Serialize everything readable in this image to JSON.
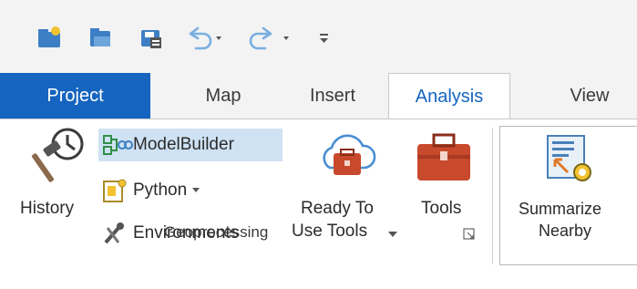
{
  "quick_access": {
    "icons": [
      "new-project-icon",
      "open-project-icon",
      "save-project-icon",
      "undo-icon",
      "redo-icon",
      "customize-icon"
    ]
  },
  "tabs": [
    {
      "label": "Project"
    },
    {
      "label": "Map"
    },
    {
      "label": "Insert"
    },
    {
      "label": "Analysis"
    },
    {
      "label": "View"
    }
  ],
  "ribbon": {
    "geoprocessing": {
      "group_label": "Geoprocessing",
      "history_label": "History",
      "modelbuilder_label": "ModelBuilder",
      "python_label": "Python",
      "environments_label": "Environments",
      "ready_tools_line1": "Ready To",
      "ready_tools_line2": "Use Tools",
      "tools_label": "Tools"
    },
    "summarize": {
      "line1": "Summarize",
      "line2": "Nearby"
    }
  },
  "colors": {
    "accent": "#1565c0",
    "selected_bg": "#cfe2f3",
    "toolbox": "#c8492c"
  }
}
